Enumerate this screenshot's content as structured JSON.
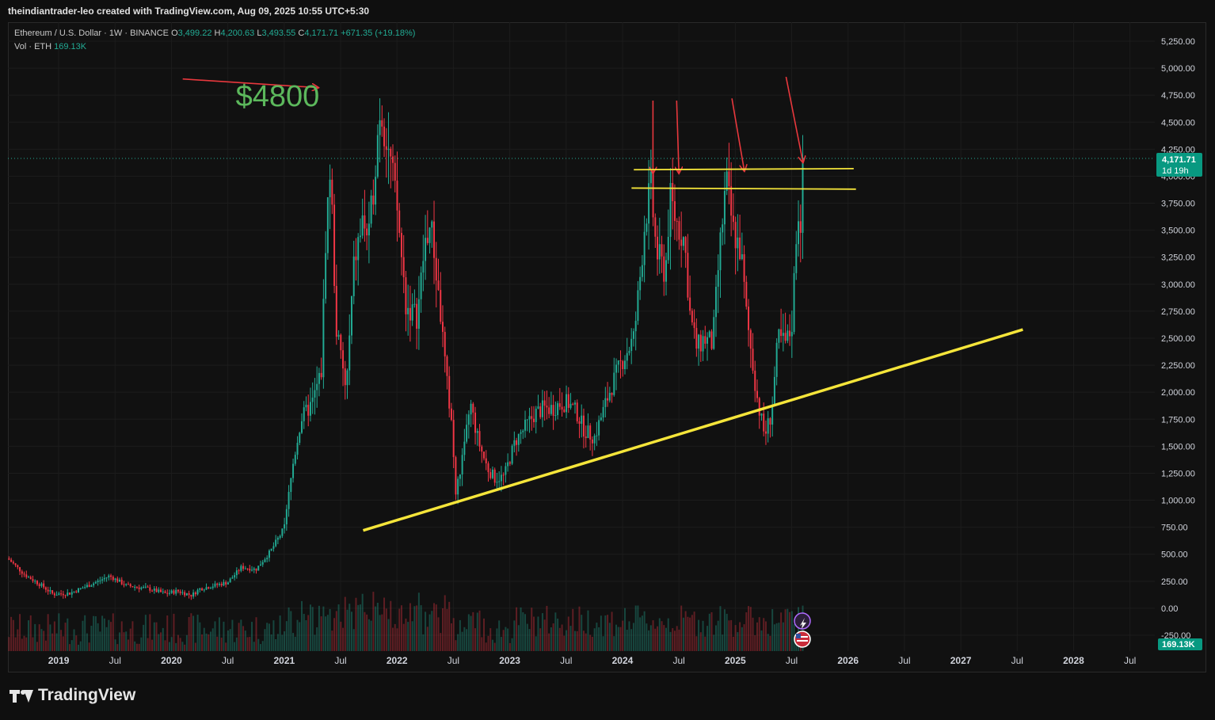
{
  "header": {
    "credit": "theindiantrader-leo created with TradingView.com, Aug 09, 2025 10:55 UTC+5:30"
  },
  "legend": {
    "symbol": "Ethereum / U.S. Dollar · 1W · BINANCE",
    "o_label": "O",
    "o_value": "3,499.22",
    "h_label": "H",
    "h_value": "4,200.63",
    "l_label": "L",
    "l_value": "3,493.55",
    "c_label": "C",
    "c_value": "4,171.71",
    "change": "+671.35 (+19.18%)",
    "vol_label": "Vol · ETH",
    "vol_value": "169.13K"
  },
  "price_badge": {
    "price": "4,171.71",
    "countdown": "1d 19h"
  },
  "volume_badge": "169.13K",
  "annotation_text": "$4800",
  "branding": "TradingView",
  "colors": {
    "up": "#22ab94",
    "down": "#f23645",
    "trendline": "#f5e53a",
    "arrow": "#e8383d",
    "annotation": "#5cb85c",
    "background": "#111111"
  },
  "chart_data": {
    "type": "candlestick",
    "title": "Ethereum / U.S. Dollar · 1W · BINANCE",
    "y_ticks": [
      "5,250.00",
      "5,000.00",
      "4,750.00",
      "4,500.00",
      "4,250.00",
      "4,000.00",
      "3,750.00",
      "3,500.00",
      "3,250.00",
      "3,000.00",
      "2,750.00",
      "2,500.00",
      "2,250.00",
      "2,000.00",
      "1,750.00",
      "1,500.00",
      "1,250.00",
      "1,000.00",
      "750.00",
      "500.00",
      "250.00",
      "0.00",
      "-250.00"
    ],
    "y_tick_values": [
      5250,
      5000,
      4750,
      4500,
      4250,
      4000,
      3750,
      3500,
      3250,
      3000,
      2750,
      2500,
      2250,
      2000,
      1750,
      1500,
      1250,
      1000,
      750,
      500,
      250,
      0,
      -250
    ],
    "x_ticks": [
      {
        "label": "2019",
        "t": 2019.0
      },
      {
        "label": "Jul",
        "t": 2019.5
      },
      {
        "label": "2020",
        "t": 2020.0
      },
      {
        "label": "Jul",
        "t": 2020.5
      },
      {
        "label": "2021",
        "t": 2021.0
      },
      {
        "label": "Jul",
        "t": 2021.5
      },
      {
        "label": "2022",
        "t": 2022.0
      },
      {
        "label": "Jul",
        "t": 2022.5
      },
      {
        "label": "2023",
        "t": 2023.0
      },
      {
        "label": "Jul",
        "t": 2023.5
      },
      {
        "label": "2024",
        "t": 2024.0
      },
      {
        "label": "Jul",
        "t": 2024.5
      },
      {
        "label": "2025",
        "t": 2025.0
      },
      {
        "label": "Jul",
        "t": 2025.5
      },
      {
        "label": "2026",
        "t": 2026.0
      },
      {
        "label": "Jul",
        "t": 2026.5
      },
      {
        "label": "2027",
        "t": 2027.0
      },
      {
        "label": "Jul",
        "t": 2027.5
      },
      {
        "label": "2028",
        "t": 2028.0
      },
      {
        "label": "Jul",
        "t": 2028.5
      }
    ],
    "x_range": [
      2018.55,
      2028.72
    ],
    "y_range": [
      -250,
      5250
    ],
    "price_anchors": [
      [
        2018.55,
        460
      ],
      [
        2018.7,
        310
      ],
      [
        2018.85,
        210
      ],
      [
        2018.95,
        130
      ],
      [
        2019.1,
        140
      ],
      [
        2019.35,
        250
      ],
      [
        2019.45,
        300
      ],
      [
        2019.6,
        210
      ],
      [
        2019.8,
        180
      ],
      [
        2019.95,
        135
      ],
      [
        2020.05,
        160
      ],
      [
        2020.18,
        120
      ],
      [
        2020.25,
        180
      ],
      [
        2020.5,
        240
      ],
      [
        2020.62,
        380
      ],
      [
        2020.75,
        360
      ],
      [
        2020.88,
        530
      ],
      [
        2021.0,
        740
      ],
      [
        2021.08,
        1350
      ],
      [
        2021.15,
        1750
      ],
      [
        2021.25,
        1900
      ],
      [
        2021.33,
        2200
      ],
      [
        2021.37,
        3500
      ],
      [
        2021.41,
        4100
      ],
      [
        2021.46,
        2600
      ],
      [
        2021.55,
        2000
      ],
      [
        2021.62,
        3200
      ],
      [
        2021.7,
        3600
      ],
      [
        2021.75,
        3400
      ],
      [
        2021.85,
        4650
      ],
      [
        2021.92,
        4300
      ],
      [
        2022.0,
        3700
      ],
      [
        2022.08,
        2800
      ],
      [
        2022.18,
        2700
      ],
      [
        2022.25,
        3400
      ],
      [
        2022.3,
        3550
      ],
      [
        2022.37,
        2900
      ],
      [
        2022.45,
        2000
      ],
      [
        2022.48,
        1800
      ],
      [
        2022.52,
        1050
      ],
      [
        2022.6,
        1500
      ],
      [
        2022.65,
        1900
      ],
      [
        2022.72,
        1550
      ],
      [
        2022.8,
        1300
      ],
      [
        2022.87,
        1200
      ],
      [
        2022.95,
        1220
      ],
      [
        2023.05,
        1550
      ],
      [
        2023.12,
        1650
      ],
      [
        2023.22,
        1800
      ],
      [
        2023.3,
        1850
      ],
      [
        2023.38,
        1850
      ],
      [
        2023.45,
        1900
      ],
      [
        2023.52,
        1900
      ],
      [
        2023.6,
        1800
      ],
      [
        2023.66,
        1650
      ],
      [
        2023.75,
        1580
      ],
      [
        2023.82,
        1800
      ],
      [
        2023.9,
        2050
      ],
      [
        2024.0,
        2300
      ],
      [
        2024.1,
        2500
      ],
      [
        2024.15,
        3000
      ],
      [
        2024.2,
        3600
      ],
      [
        2024.25,
        3900
      ],
      [
        2024.3,
        3300
      ],
      [
        2024.38,
        3100
      ],
      [
        2024.42,
        3800
      ],
      [
        2024.47,
        3600
      ],
      [
        2024.55,
        3400
      ],
      [
        2024.6,
        2700
      ],
      [
        2024.66,
        2400
      ],
      [
        2024.72,
        2500
      ],
      [
        2024.8,
        2450
      ],
      [
        2024.86,
        3300
      ],
      [
        2024.92,
        3950
      ],
      [
        2024.98,
        3500
      ],
      [
        2025.05,
        3300
      ],
      [
        2025.1,
        2700
      ],
      [
        2025.15,
        2300
      ],
      [
        2025.2,
        1900
      ],
      [
        2025.26,
        1600
      ],
      [
        2025.32,
        1800
      ],
      [
        2025.38,
        2500
      ],
      [
        2025.45,
        2450
      ],
      [
        2025.5,
        2600
      ],
      [
        2025.52,
        3000
      ],
      [
        2025.55,
        3700
      ],
      [
        2025.58,
        3600
      ],
      [
        2025.61,
        4172
      ]
    ],
    "series": [
      {
        "name": "ETH/USD weekly candles",
        "values_from": "price_anchors"
      },
      {
        "name": "Vol · ETH",
        "last": "169.13K"
      }
    ],
    "annotations": [
      {
        "type": "text",
        "text": "$4800",
        "t": 2020.57,
        "y": 4750
      },
      {
        "type": "arrow",
        "from": [
          2020.1,
          4900
        ],
        "to": [
          2021.3,
          4820
        ]
      },
      {
        "type": "arrow",
        "from": [
          2024.27,
          4700
        ],
        "to": [
          2024.27,
          4030
        ]
      },
      {
        "type": "arrow",
        "from": [
          2024.48,
          4700
        ],
        "to": [
          2024.5,
          4030
        ]
      },
      {
        "type": "arrow",
        "from": [
          2024.97,
          4720
        ],
        "to": [
          2025.08,
          4050
        ]
      },
      {
        "type": "arrow",
        "from": [
          2025.45,
          4920
        ],
        "to": [
          2025.6,
          4130
        ]
      },
      {
        "type": "hline",
        "from": [
          2024.1,
          4060
        ],
        "to": [
          2026.05,
          4070
        ],
        "color": "trendline"
      },
      {
        "type": "hline",
        "from": [
          2024.08,
          3890
        ],
        "to": [
          2026.07,
          3880
        ],
        "color": "trendline"
      },
      {
        "type": "trendline",
        "from": [
          2021.7,
          720
        ],
        "to": [
          2027.55,
          2580
        ],
        "color": "trendline"
      }
    ],
    "grid": true
  }
}
